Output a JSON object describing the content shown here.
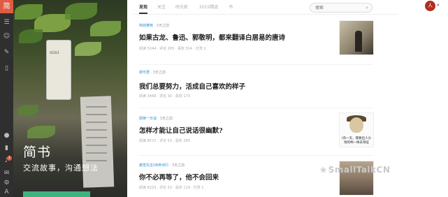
{
  "sidebar": {
    "logo": "简",
    "icons": [
      "menu-icon",
      "friends-icon",
      "pen-icon",
      "mobile-icon",
      "user-icon",
      "bookmark-icon",
      "bell-icon",
      "mail-icon",
      "settings-icon",
      "font-icon"
    ],
    "notification_count": "1"
  },
  "hero": {
    "title": "简书",
    "slogan": "交流故事，沟通想法",
    "sign_text": "mini"
  },
  "nav": {
    "tabs": [
      {
        "label": "发现",
        "active": true
      },
      {
        "label": "关注",
        "active": false
      },
      {
        "label": "时光机",
        "active": false
      },
      {
        "label": "2015精选",
        "active": false
      },
      {
        "label": "书",
        "active": false
      }
    ],
    "search_placeholder": "搜索"
  },
  "articles": [
    {
      "author": "简叔推荐",
      "time": "· 3天之前",
      "title": "如果古龙、鲁迅、郭敬明，都来翻译白居易的唐诗",
      "stats": "阅读 5244 · 评论 265 · 喜欢 314 · 打赏 2"
    },
    {
      "author": "谢可君",
      "time": "· 3天之前",
      "title": "我们总要努力，活成自己喜欢的样子",
      "stats": "阅读 3468 · 评论 30 · 喜欢 173"
    },
    {
      "author": "顾荣一日谈",
      "time": "· 3天之前",
      "title": "怎样才能让自己说话很幽默?",
      "stats": "阅读 8572 · 评论 53 · 喜欢 285",
      "thumb_caption": "(有一天，我要出人头地的哟一样去领证"
    },
    {
      "author": "傲雪先生DB养诗行",
      "time": "· 3天之前",
      "title": "你不必再等了，他不会回来",
      "stats": "阅读 8223 · 评论 53 · 喜欢 119 · 打赏 1"
    }
  ],
  "watermark": "SmallTalkCN",
  "colors": {
    "brand": "#e05b42",
    "author_link": "#3194d0",
    "rail": "#2f2f2f",
    "avatar": "#b22d1c"
  }
}
